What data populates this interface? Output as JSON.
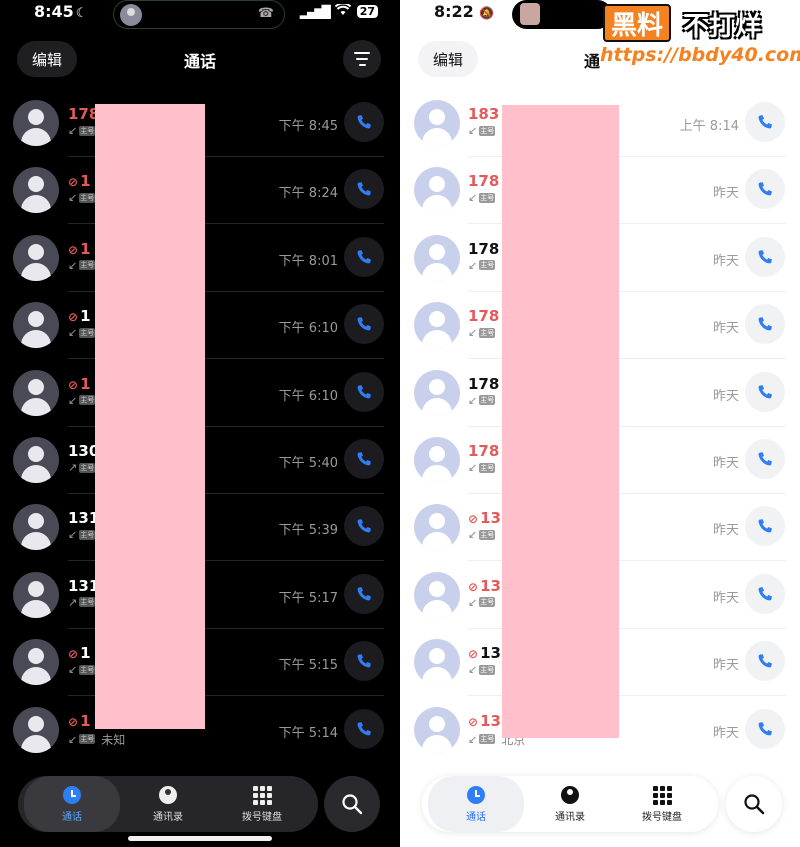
{
  "left": {
    "status": {
      "time": "8:45",
      "battery": "27"
    },
    "header": {
      "edit": "编辑",
      "title": "通话"
    },
    "rows": [
      {
        "name": "178",
        "missed": true,
        "blocked": false,
        "dir": "in",
        "sim": "主号",
        "time": "下午 8:45",
        "note": ""
      },
      {
        "name": "1",
        "missed": true,
        "blocked": true,
        "dir": "in",
        "sim": "主号",
        "time": "下午 8:24",
        "note": ""
      },
      {
        "name": "1",
        "missed": true,
        "blocked": true,
        "dir": "in",
        "sim": "主号",
        "time": "下午 8:01",
        "note": ""
      },
      {
        "name": "1",
        "missed": false,
        "blocked": true,
        "dir": "in",
        "sim": "主号",
        "time": "下午 6:10",
        "note": ""
      },
      {
        "name": "1",
        "missed": true,
        "blocked": true,
        "dir": "in",
        "sim": "主号",
        "time": "下午 6:10",
        "note": ""
      },
      {
        "name": "130",
        "missed": false,
        "blocked": false,
        "dir": "out",
        "sim": "主号",
        "time": "下午 5:40",
        "note": ""
      },
      {
        "name": "131",
        "missed": false,
        "blocked": false,
        "dir": "in",
        "sim": "主号",
        "time": "下午 5:39",
        "note": ""
      },
      {
        "name": "131",
        "missed": false,
        "blocked": false,
        "dir": "out",
        "sim": "主号",
        "time": "下午 5:17",
        "note": ""
      },
      {
        "name": "1",
        "missed": false,
        "blocked": true,
        "dir": "in",
        "sim": "主号",
        "time": "下午 5:15",
        "note": ""
      },
      {
        "name": "1",
        "missed": true,
        "blocked": true,
        "dir": "in",
        "sim": "主号",
        "time": "下午 5:14",
        "note": "未知"
      }
    ],
    "nav": {
      "recents": "通话",
      "contacts": "通讯录",
      "dialpad": "拨号键盘"
    }
  },
  "right": {
    "status": {
      "time": "8:22"
    },
    "header": {
      "edit": "编辑",
      "title": "通"
    },
    "rows": [
      {
        "name": "183",
        "missed": true,
        "blocked": false,
        "dir": "in",
        "sim": "主号",
        "time": "上午 8:14",
        "note": ""
      },
      {
        "name": "178",
        "missed": true,
        "blocked": false,
        "dir": "in",
        "sim": "主号",
        "time": "昨天",
        "note": ""
      },
      {
        "name": "178",
        "missed": false,
        "blocked": false,
        "dir": "in",
        "sim": "主号",
        "time": "昨天",
        "note": ""
      },
      {
        "name": "178",
        "missed": true,
        "blocked": false,
        "dir": "in",
        "sim": "主号",
        "time": "昨天",
        "note": ""
      },
      {
        "name": "178",
        "missed": false,
        "blocked": false,
        "dir": "in",
        "sim": "主号",
        "time": "昨天",
        "note": ""
      },
      {
        "name": "178",
        "missed": true,
        "blocked": false,
        "dir": "in",
        "sim": "主号",
        "time": "昨天",
        "note": ""
      },
      {
        "name": "13",
        "missed": true,
        "blocked": true,
        "dir": "in",
        "sim": "主号",
        "time": "昨天",
        "note": ""
      },
      {
        "name": "13",
        "missed": true,
        "blocked": true,
        "dir": "in",
        "sim": "主号",
        "time": "昨天",
        "note": ""
      },
      {
        "name": "13",
        "missed": false,
        "blocked": true,
        "dir": "in",
        "sim": "主号",
        "time": "昨天",
        "note": ""
      },
      {
        "name": "13",
        "missed": true,
        "blocked": true,
        "dir": "in",
        "sim": "主号",
        "time": "昨天",
        "note": "北京"
      }
    ],
    "nav": {
      "recents": "通话",
      "contacts": "通讯录",
      "dialpad": "拨号键盘"
    }
  },
  "watermark": {
    "badge": "黑料",
    "text": "不打烊",
    "url": "https://bbdy40.com"
  },
  "colors": {
    "missed": "#e25a5a",
    "accent": "#2f7ef5",
    "redaction": "#ffc0cb",
    "watermark": "#f58220"
  },
  "icons": {
    "filter": "filter-lines-icon",
    "call": "phone-icon",
    "blocked": "block-icon",
    "incoming": "arrow-incoming-icon",
    "outgoing": "arrow-outgoing-icon",
    "recents": "clock-icon",
    "contacts": "person-icon",
    "dialpad": "keypad-icon",
    "search": "search-icon"
  }
}
